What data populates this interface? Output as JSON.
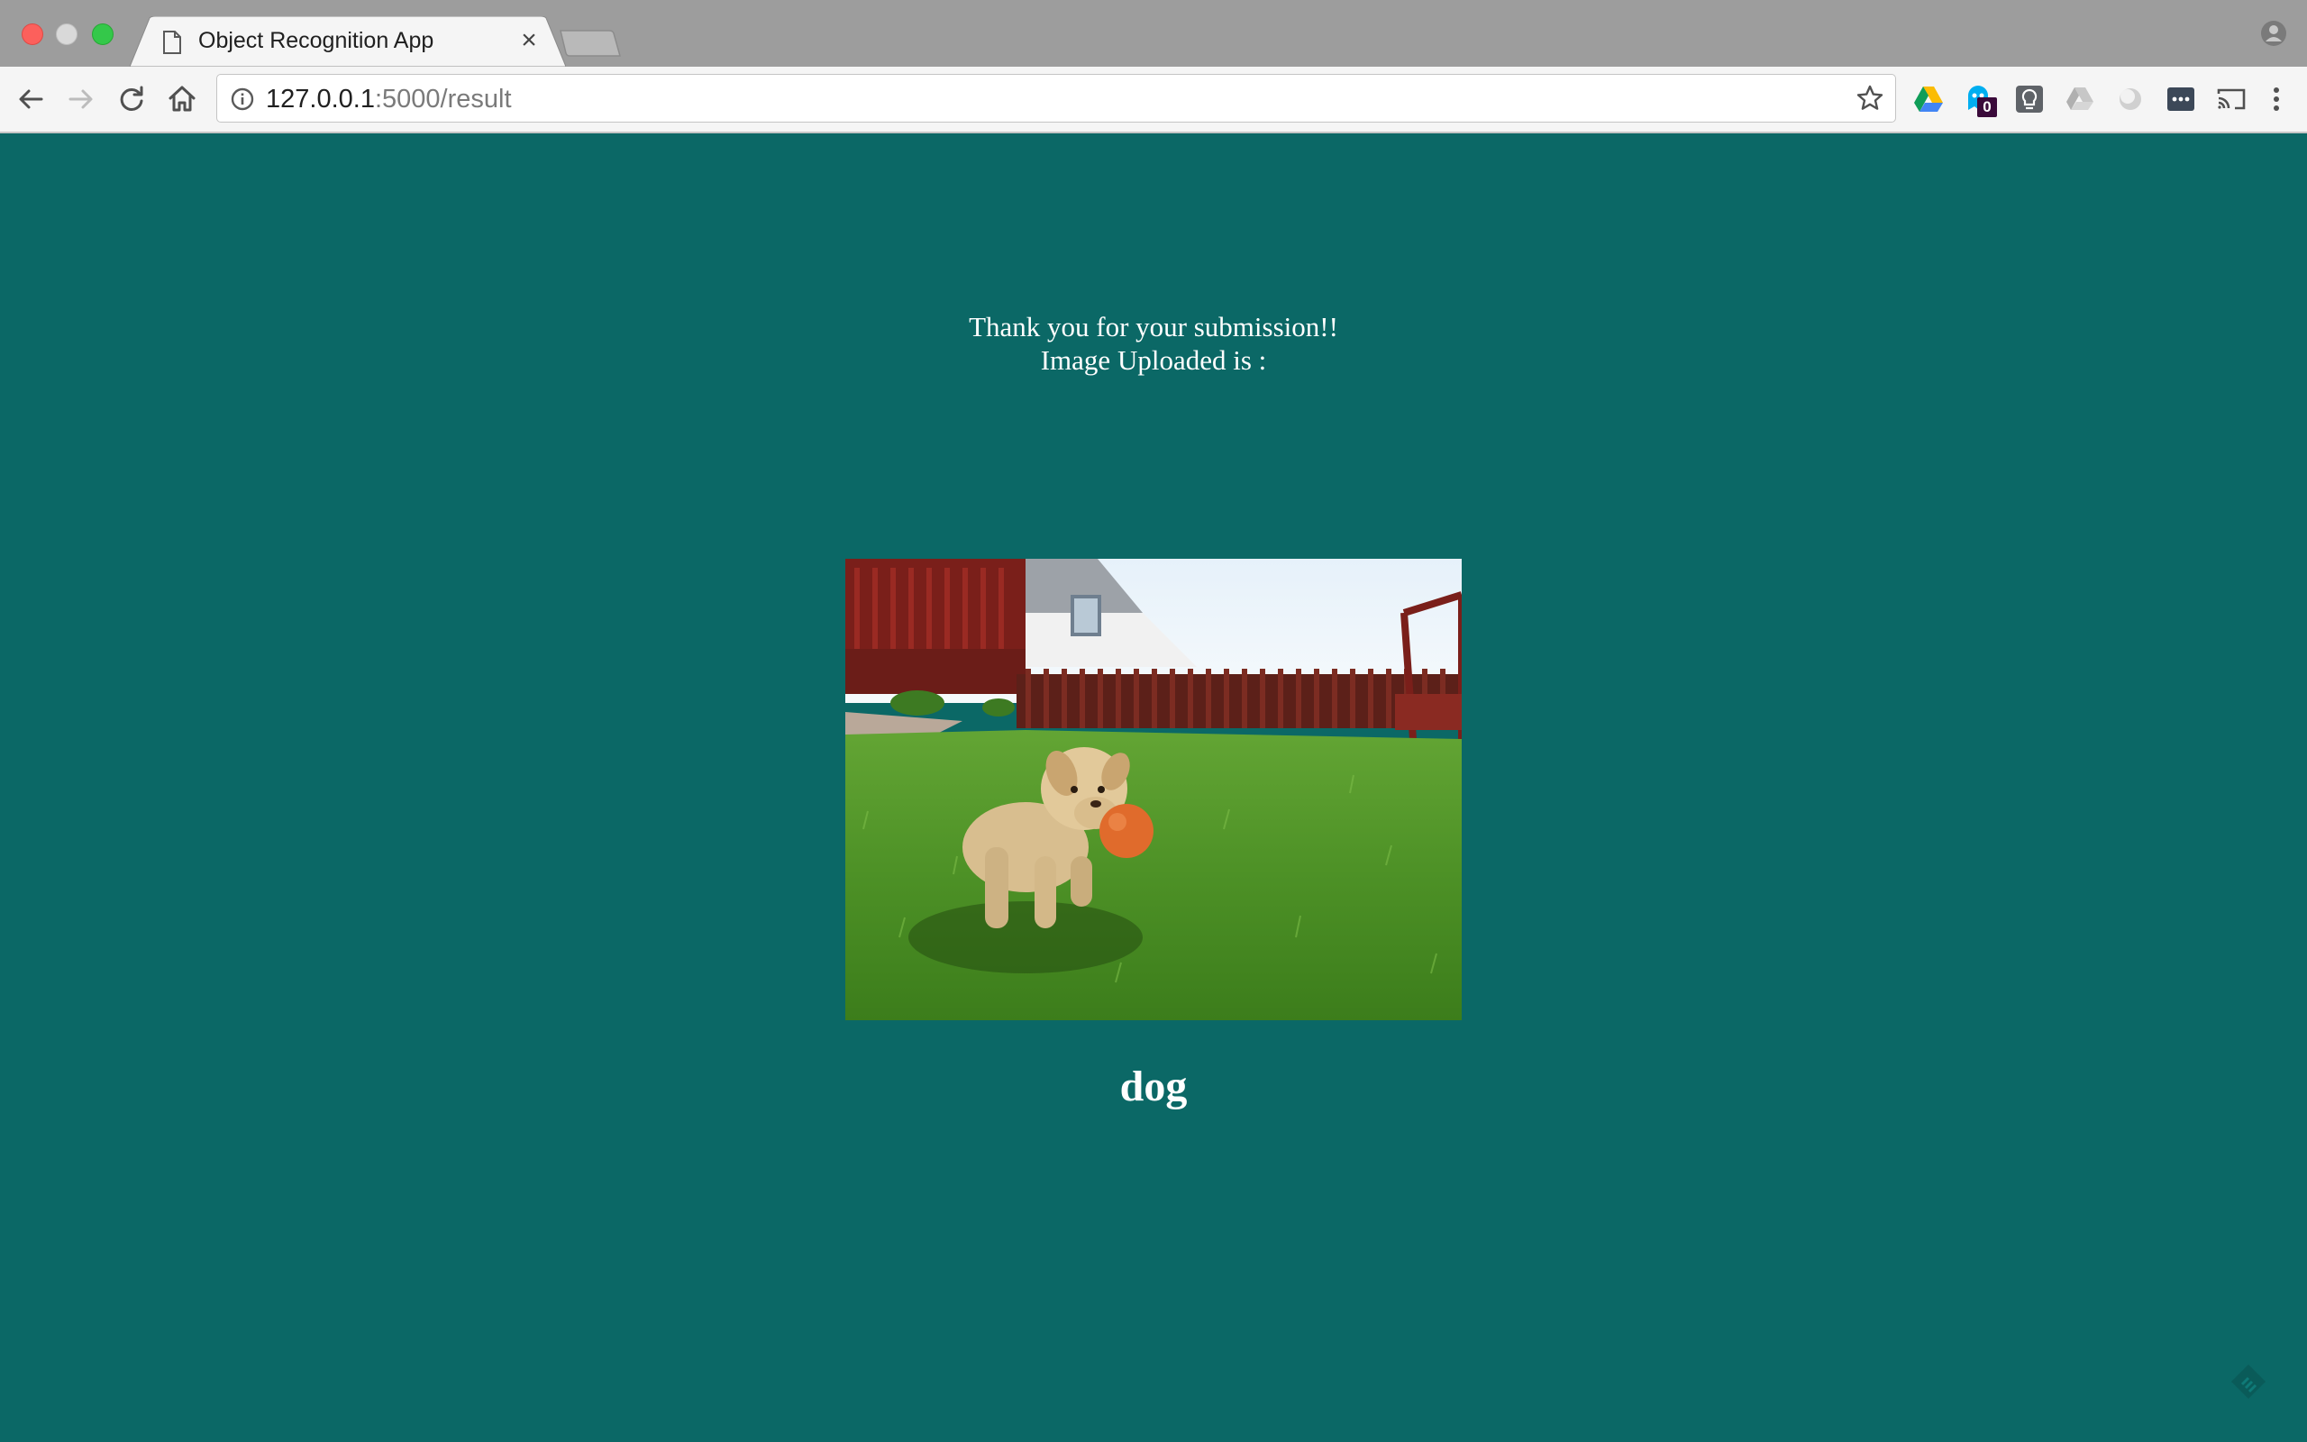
{
  "browser": {
    "tab": {
      "title": "Object Recognition App"
    },
    "address_bar": {
      "host": "127.0.0.1",
      "rest": ":5000/result"
    },
    "extensions": {
      "badge_count": "0"
    }
  },
  "page": {
    "message_line1": "Thank you for your submission!!",
    "message_line2": "Image Uploaded is :",
    "prediction": "dog"
  },
  "colors": {
    "page_background": "#0b6866",
    "text": "#ffffff"
  }
}
